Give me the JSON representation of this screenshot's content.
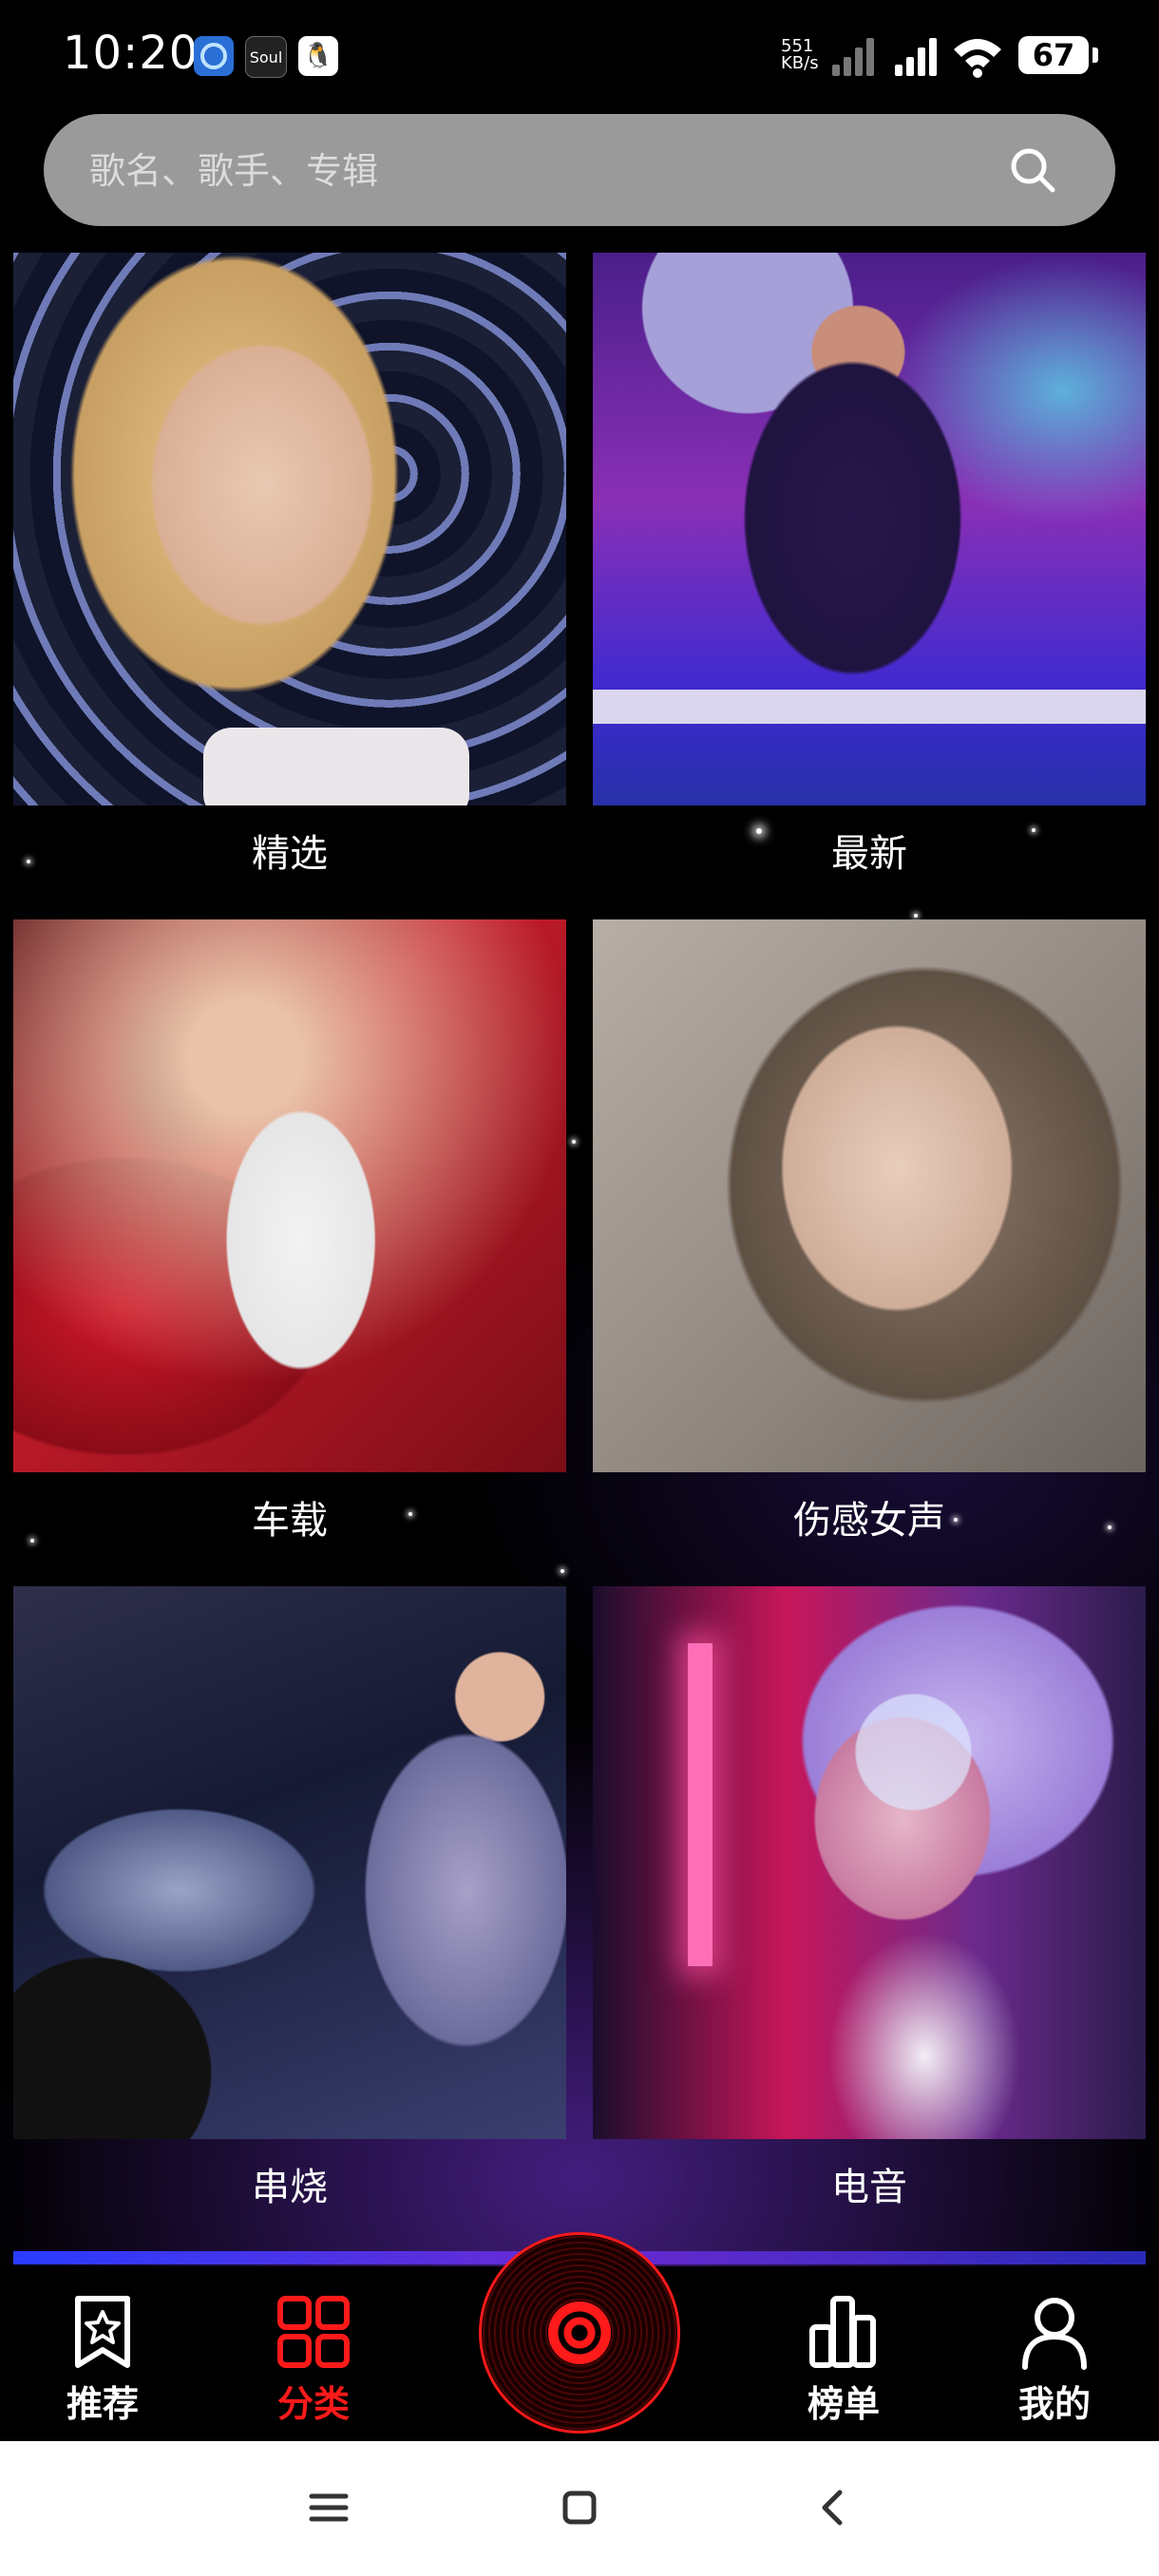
{
  "status_bar": {
    "time": "10:20",
    "apps": [
      "",
      "Soul",
      "🐧"
    ],
    "net_speed_value": "551",
    "net_speed_unit": "KB/s",
    "battery": "67"
  },
  "search": {
    "placeholder": "歌名、歌手、专辑"
  },
  "categories": [
    {
      "label": "精选"
    },
    {
      "label": "最新"
    },
    {
      "label": "车载"
    },
    {
      "label": "伤感女声"
    },
    {
      "label": "串烧"
    },
    {
      "label": "电音"
    }
  ],
  "tab_bar": {
    "active_color": "#ff1a1a",
    "items": [
      {
        "label": "推荐",
        "icon": "star-bookmark-icon"
      },
      {
        "label": "分类",
        "icon": "grid-icon",
        "active": true
      },
      {
        "label": "",
        "icon": "vinyl-disc-icon"
      },
      {
        "label": "榜单",
        "icon": "bar-chart-icon"
      },
      {
        "label": "我的",
        "icon": "person-icon"
      }
    ]
  },
  "system_nav": {
    "icons": [
      "menu-icon",
      "home-icon",
      "back-icon"
    ]
  }
}
